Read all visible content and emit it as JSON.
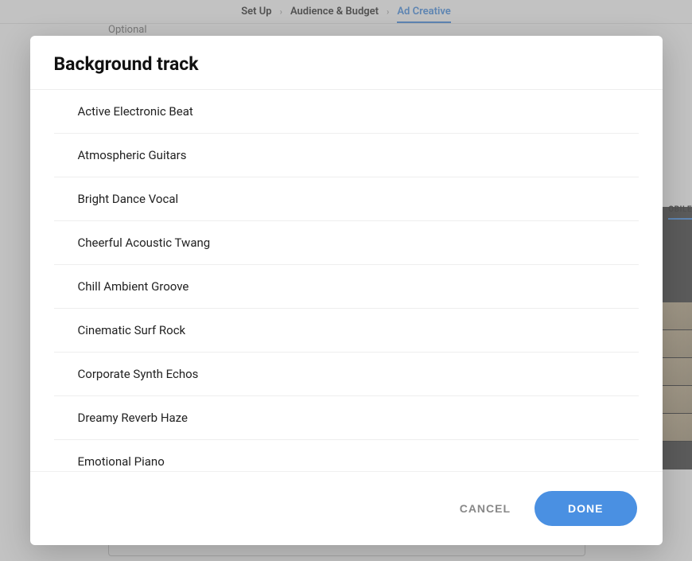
{
  "breadcrumbs": {
    "step1": "Set Up",
    "step2": "Audience & Budget",
    "step3": "Ad Creative"
  },
  "background": {
    "optional_label": "Optional",
    "side_tab": "OBILE"
  },
  "modal": {
    "title": "Background track",
    "tracks": [
      "Active Electronic Beat",
      "Atmospheric Guitars",
      "Bright Dance Vocal",
      "Cheerful Acoustic Twang",
      "Chill Ambient Groove",
      "Cinematic Surf Rock",
      "Corporate Synth Echos",
      "Dreamy Reverb Haze",
      "Emotional Piano"
    ],
    "cancel_label": "CANCEL",
    "done_label": "DONE"
  }
}
